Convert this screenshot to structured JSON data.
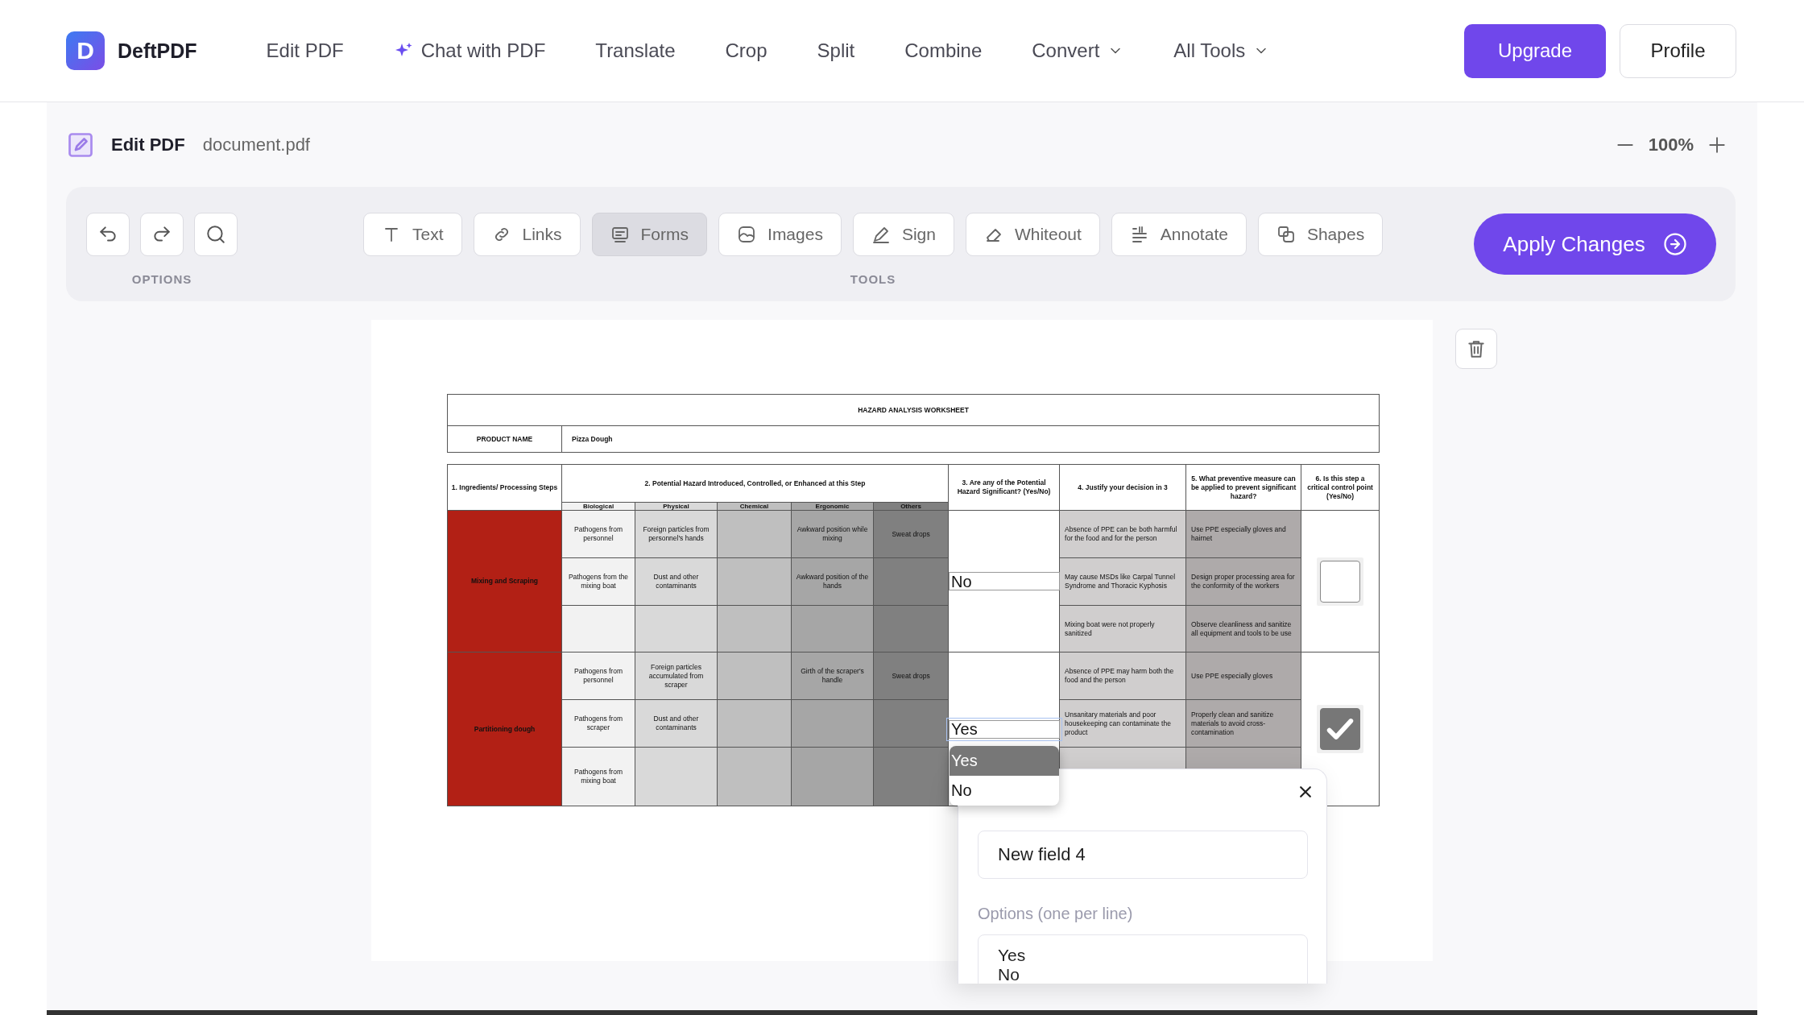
{
  "app": {
    "logo_letter": "D",
    "name": "DeftPDF"
  },
  "nav": [
    {
      "label": "Edit PDF",
      "kind": "plain"
    },
    {
      "label": "Chat with PDF",
      "kind": "ai"
    },
    {
      "label": "Translate",
      "kind": "plain"
    },
    {
      "label": "Crop",
      "kind": "plain"
    },
    {
      "label": "Split",
      "kind": "plain"
    },
    {
      "label": "Combine",
      "kind": "plain"
    },
    {
      "label": "Convert",
      "kind": "menu"
    },
    {
      "label": "All Tools",
      "kind": "menu"
    }
  ],
  "header_buttons": [
    {
      "label": "Upgrade",
      "kind": "primary"
    },
    {
      "label": "Profile",
      "kind": "secondary"
    }
  ],
  "editor": {
    "title": "Edit PDF",
    "filename": "document.pdf",
    "zoom": "100%"
  },
  "toolbar": {
    "options_label": "OPTIONS",
    "tools_label": "TOOLS",
    "apply": "Apply Changes",
    "tools": [
      {
        "label": "Text",
        "selected": false
      },
      {
        "label": "Links",
        "selected": false
      },
      {
        "label": "Forms",
        "selected": true
      },
      {
        "label": "Images",
        "selected": false
      },
      {
        "label": "Sign",
        "selected": false
      },
      {
        "label": "Whiteout",
        "selected": false
      },
      {
        "label": "Annotate",
        "selected": false
      },
      {
        "label": "Shapes",
        "selected": false
      }
    ]
  },
  "worksheet": {
    "title": "HAZARD ANALYSIS WORKSHEET",
    "product_label": "PRODUCT NAME",
    "product": "Pizza Dough",
    "headers": [
      "1. Ingredients/ Processing Steps",
      "2. Potential Hazard Introduced, Controlled, or Enhanced at this Step",
      "3. Are any of the Potential Hazard Significant? (Yes/No)",
      "4. Justify your decision in 3",
      "5. What preventive measure can be applied to prevent significant hazard?",
      "6. Is this step a critical control point (Yes/No)"
    ],
    "hazard_types": [
      "Biological",
      "Physical",
      "Chemical",
      "Ergonomic",
      "Others"
    ],
    "groups": [
      {
        "step": "Mixing and Scraping",
        "significant": {
          "kind": "text",
          "value": "No"
        },
        "ccp_checked": false,
        "rows": [
          {
            "hazards": {
              "biological": "Pathogens from personnel",
              "physical": "Foreign particles from personnel's hands",
              "ergonomic": "Awkward position while mixing",
              "others": "Sweat drops"
            },
            "justification": "Absence of PPE can be both harmful for the food and for the person",
            "measure": "Use PPE especially gloves and hairnet"
          },
          {
            "hazards": {
              "biological": "Pathogens from the mixing boat",
              "physical": "Dust and other contaminants",
              "ergonomic": "Awkward position of the hands"
            },
            "justification": "May cause MSDs like Carpal Tunnel Syndrome and Thoracic Kyphosis",
            "measure": "Design proper processing area for the conformity of the workers"
          },
          {
            "justification": "Mixing boat were not properly sanitized",
            "measure": "Observe cleanliness and sanitize all equipment and tools to be use"
          }
        ]
      },
      {
        "step": "Partitioning dough",
        "significant": {
          "kind": "select",
          "value": "Yes",
          "options": [
            {
              "label": "Yes",
              "selected": true
            },
            {
              "label": "No",
              "selected": false
            }
          ]
        },
        "ccp_checked": true,
        "rows": [
          {
            "hazards": {
              "biological": "Pathogens from personnel",
              "physical": "Foreign particles accumulated from scraper",
              "ergonomic": "Girth of the scraper's handle",
              "others": "Sweat drops"
            },
            "justification": "Absence of PPE may harm both the food and the person",
            "measure": "Use PPE especially gloves"
          },
          {
            "hazards": {
              "biological": "Pathogens from scraper",
              "physical": "Dust and other contaminants"
            },
            "justification": "Unsanitary materials and poor housekeeping can contaminate the product",
            "measure": "Properly clean and sanitize materials to avoid cross-contamination"
          },
          {
            "hazards": {
              "biological": "Pathogens from mixing boat"
            }
          }
        ]
      }
    ]
  },
  "field_panel": {
    "field_name": "New field 4",
    "options_label": "Options (one per line)",
    "options_value": "Yes\nNo"
  }
}
